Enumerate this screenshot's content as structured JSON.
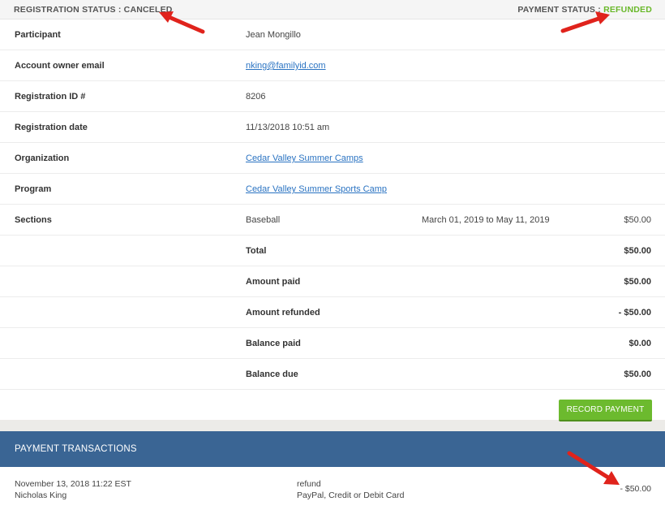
{
  "status": {
    "registration_label": "REGISTRATION STATUS : ",
    "registration_value": "CANCELED",
    "payment_label": "PAYMENT STATUS : ",
    "payment_value": "REFUNDED",
    "payment_color": "#69b82a"
  },
  "details": {
    "participant_label": "Participant",
    "participant_value": "Jean Mongillo",
    "email_label": "Account owner email",
    "email_value": "nking@familyid.com",
    "regid_label": "Registration ID #",
    "regid_value": "8206",
    "regdate_label": "Registration date",
    "regdate_value": "11/13/2018 10:51 am",
    "org_label": "Organization",
    "org_value": "Cedar Valley Summer Camps",
    "program_label": "Program",
    "program_value": "Cedar Valley Summer Sports Camp",
    "sections_label": "Sections",
    "section_name": "Baseball",
    "section_dates": "March 01, 2019 to May 11, 2019",
    "section_amount": "$50.00"
  },
  "summary": {
    "total_label": "Total",
    "total_value": "$50.00",
    "paid_label": "Amount paid",
    "paid_value": "$50.00",
    "refunded_label": "Amount refunded",
    "refunded_value": "- $50.00",
    "balance_paid_label": "Balance paid",
    "balance_paid_value": "$0.00",
    "balance_due_label": "Balance due",
    "balance_due_value": "$50.00"
  },
  "actions": {
    "record_payment": "RECORD PAYMENT"
  },
  "transactions": {
    "header": "PAYMENT TRANSACTIONS",
    "items": [
      {
        "datetime": "November 13, 2018 11:22 EST",
        "person": "Nicholas King",
        "type": "refund",
        "method": "PayPal, Credit or Debit Card",
        "amount": "- $50.00"
      }
    ]
  },
  "colors": {
    "accent_green": "#6cba2e",
    "header_blue": "#3a6594",
    "link_blue": "#2a73c2",
    "arrow_red": "#e0231c"
  }
}
